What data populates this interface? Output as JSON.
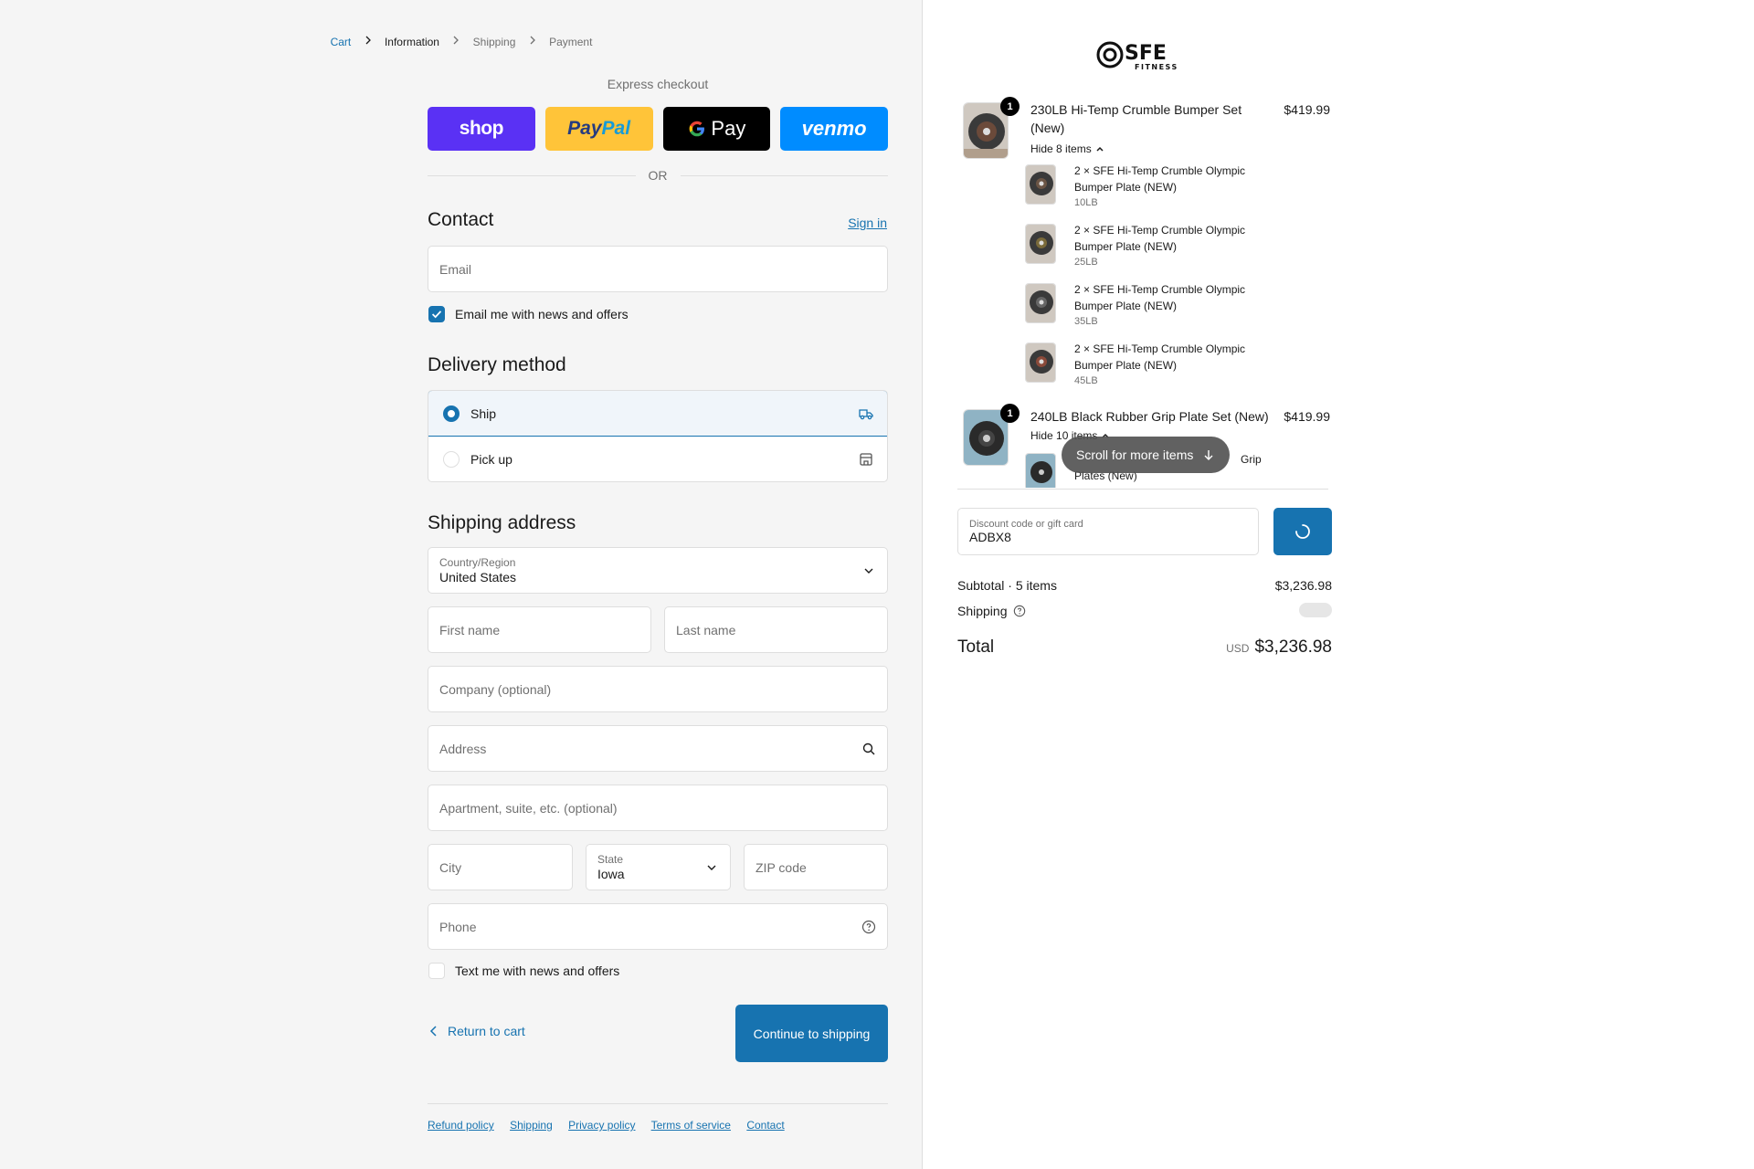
{
  "breadcrumb": {
    "cart": "Cart",
    "information": "Information",
    "shipping": "Shipping",
    "payment": "Payment"
  },
  "express": {
    "title": "Express checkout",
    "shop_label": "shop",
    "paypal_part1": "Pay",
    "paypal_part2": "Pal",
    "gpay_label": "Pay",
    "venmo_label": "venmo",
    "or_label": "OR"
  },
  "contact": {
    "heading": "Contact",
    "sign_in": "Sign in",
    "email_placeholder": "Email",
    "email_optin_label": "Email me with news and offers",
    "email_optin_checked": true
  },
  "delivery": {
    "heading": "Delivery method",
    "options": [
      {
        "label": "Ship",
        "selected": true,
        "icon": "truck-icon"
      },
      {
        "label": "Pick up",
        "selected": false,
        "icon": "store-icon"
      }
    ]
  },
  "shipping_address": {
    "heading": "Shipping address",
    "country_label": "Country/Region",
    "country_value": "United States",
    "first_name_placeholder": "First name",
    "last_name_placeholder": "Last name",
    "company_placeholder": "Company (optional)",
    "address_placeholder": "Address",
    "apartment_placeholder": "Apartment, suite, etc. (optional)",
    "city_placeholder": "City",
    "state_label": "State",
    "state_value": "Iowa",
    "zip_placeholder": "ZIP code",
    "phone_placeholder": "Phone",
    "sms_optin_label": "Text me with news and offers",
    "sms_optin_checked": false
  },
  "actions": {
    "return_label": "Return to cart",
    "continue_label": "Continue to shipping"
  },
  "footer": {
    "links": [
      "Refund policy",
      "Shipping",
      "Privacy policy",
      "Terms of service",
      "Contact"
    ]
  },
  "brand": {
    "logo_text": "SFE",
    "logo_subtext": "FITNESS"
  },
  "order": {
    "items": [
      {
        "name": "230LB Hi-Temp Crumble Bumper Set (New)",
        "price": "$419.99",
        "quantity": "1",
        "toggle_label": "Hide 8 items",
        "sub_items": [
          {
            "name": "2 × SFE Hi-Temp Crumble Olympic Bumper Plate (NEW)",
            "variant": "10LB"
          },
          {
            "name": "2 × SFE Hi-Temp Crumble Olympic Bumper Plate (NEW)",
            "variant": "25LB"
          },
          {
            "name": "2 × SFE Hi-Temp Crumble Olympic Bumper Plate (NEW)",
            "variant": "35LB"
          },
          {
            "name": "2 × SFE Hi-Temp Crumble Olympic Bumper Plate (NEW)",
            "variant": "45LB"
          }
        ]
      },
      {
        "name": "240LB Black Rubber Grip Plate Set (New)",
        "price": "$419.99",
        "quantity": "1",
        "toggle_label": "Hide 10 items",
        "sub_items": [
          {
            "name_visible_end": "Grip",
            "name_line2": "Plates (New)"
          }
        ]
      }
    ],
    "scroll_hint": "Scroll for more items",
    "discount_label": "Discount code or gift card",
    "discount_value": "ADBX8",
    "subtotal_label": "Subtotal · 5 items",
    "subtotal_value": "$3,236.98",
    "shipping_label": "Shipping",
    "total_label": "Total",
    "total_currency": "USD",
    "total_value": "$3,236.98"
  },
  "colors": {
    "accent": "#1773b0",
    "left_bg": "#f5f5f5",
    "shop": "#5a31f4",
    "paypal": "#ffc439",
    "venmo": "#008cff"
  }
}
